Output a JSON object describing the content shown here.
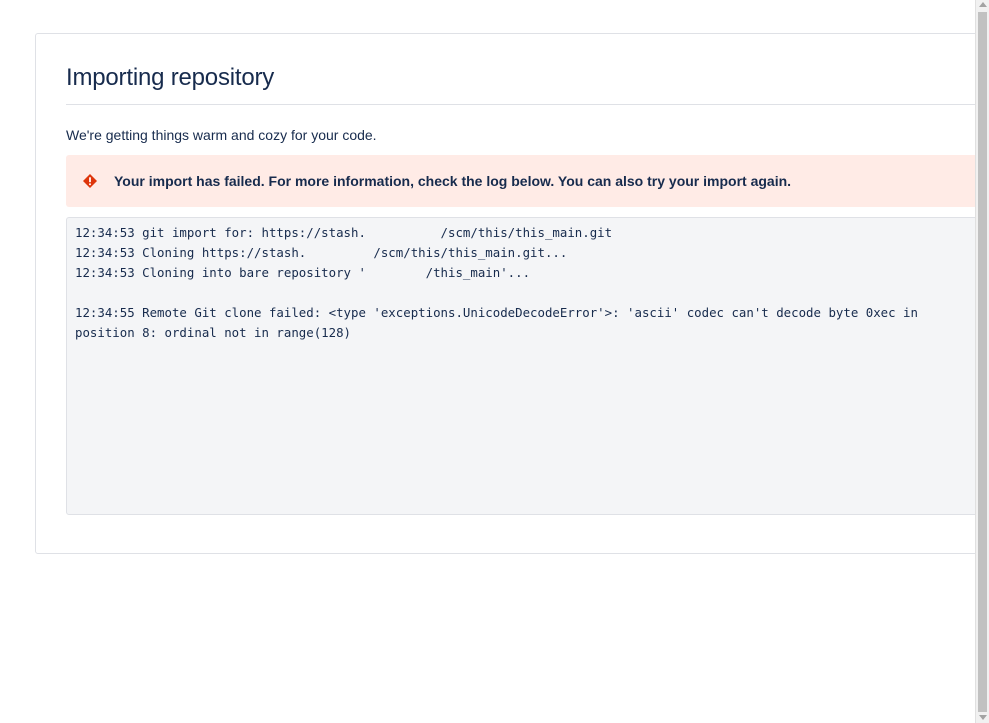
{
  "page": {
    "title": "Importing repository",
    "subtitle": "We're getting things warm and cozy for your code."
  },
  "error_banner": {
    "icon": "error-icon",
    "message": "Your import has failed. For more information, check the log below. You can also try your import again.",
    "color": "#de350b",
    "background": "#ffebe6"
  },
  "log": {
    "lines": [
      "12:34:53 git import for: https://stash.          /scm/this/this_main.git",
      "12:34:53 Cloning https://stash.         /scm/this/this_main.git...",
      "12:34:53 Cloning into bare repository '        /this_main'...",
      "",
      "12:34:55 Remote Git clone failed: <type 'exceptions.UnicodeDecodeError'>: 'ascii' codec can't decode byte 0xec in position 8: ordinal not in range(128)"
    ]
  }
}
